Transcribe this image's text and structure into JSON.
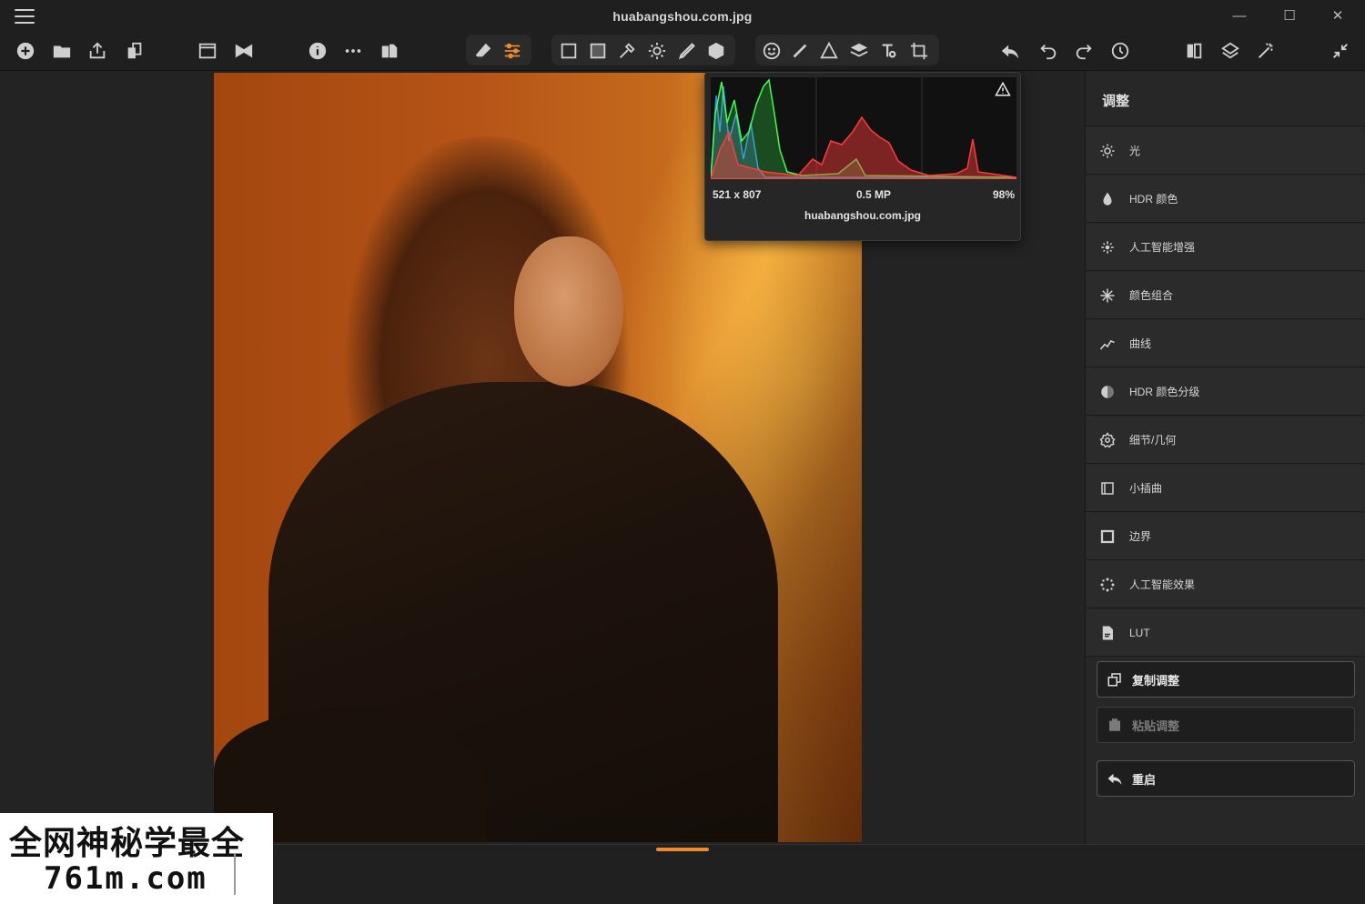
{
  "window": {
    "title": "huabangshou.com.jpg",
    "minimize": "—",
    "maximize": "☐",
    "close": "✕"
  },
  "toolbar": {
    "icons": [
      "add-icon",
      "folder-icon",
      "share-icon",
      "copy-icon",
      "window-icon",
      "compare-icon",
      "info-icon",
      "more-icon",
      "export-icon",
      "erase-icon",
      "adjust-sliders-icon",
      "crop-frame-icon",
      "filled-square-icon",
      "eyedropper-icon",
      "brightness-icon",
      "brush-icon",
      "cube-icon",
      "face-icon",
      "healing-icon",
      "triangle-icon",
      "layers-icon",
      "text-icon",
      "transform-icon",
      "undo-curved-icon",
      "undo-icon",
      "redo-icon",
      "history-icon",
      "split-view-icon",
      "ai-layers-icon",
      "magic-wand-icon",
      "collapse-icon"
    ]
  },
  "histogram": {
    "dimensions": "521 x 807",
    "megapixels": "0.5 MP",
    "zoom": "98%",
    "filename": "huabangshou.com.jpg",
    "warning_icon": "warning-icon",
    "colors": {
      "red": "#ff3b3b",
      "green": "#3dff4a",
      "blue": "#3f7dff"
    }
  },
  "panel": {
    "title": "调整",
    "items": [
      {
        "label": "光",
        "icon": "sun-icon"
      },
      {
        "label": "HDR 颜色",
        "icon": "drop-icon"
      },
      {
        "label": "人工智能增强",
        "icon": "ai-sparkle-icon"
      },
      {
        "label": "颜色组合",
        "icon": "star-burst-icon"
      },
      {
        "label": "曲线",
        "icon": "curve-icon"
      },
      {
        "label": "HDR 颜色分级",
        "icon": "color-wheel-icon"
      },
      {
        "label": "细节/几何",
        "icon": "gear-icon"
      },
      {
        "label": "小插曲",
        "icon": "vignette-icon"
      },
      {
        "label": "边界",
        "icon": "border-icon"
      },
      {
        "label": "人工智能效果",
        "icon": "ai-effect-icon"
      },
      {
        "label": "LUT",
        "icon": "lut-file-icon"
      }
    ],
    "buttons": {
      "copy": {
        "label": "复制调整",
        "icon": "copy-adjust-icon"
      },
      "paste": {
        "label": "粘贴调整",
        "icon": "paste-icon"
      },
      "reset": {
        "label": "重启",
        "icon": "reset-arrow-icon"
      }
    }
  },
  "watermark": {
    "line1": "全网神秘学最全",
    "line2": "761m.com"
  },
  "accent_color": "#f08a2a"
}
